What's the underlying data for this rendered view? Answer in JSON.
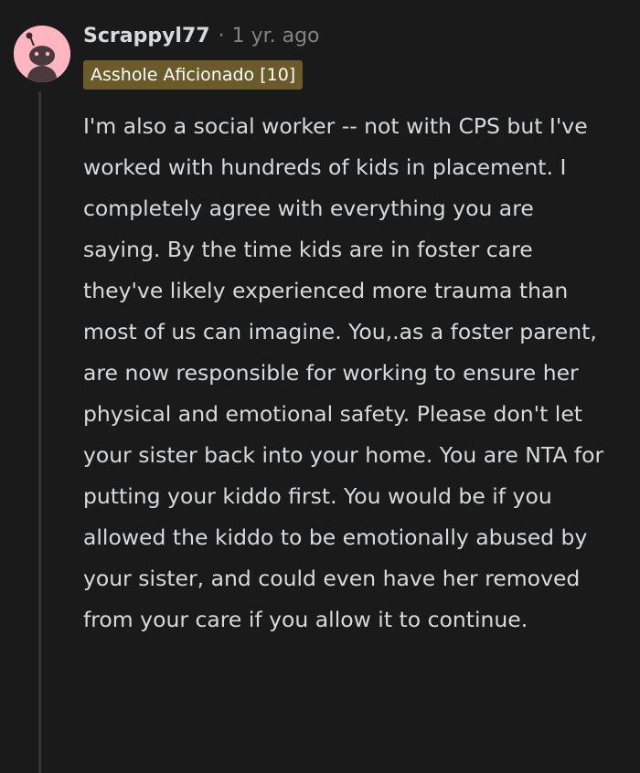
{
  "comment": {
    "username": "Scrappyl77",
    "separator": "·",
    "timestamp": "1 yr. ago",
    "flair": "Asshole Aficionado [10]",
    "flair_color": "#6b5b2a",
    "avatar_icon": "snoo-avatar-icon",
    "avatar_color": "#ffb6c1",
    "body": "I'm also a social worker -- not with CPS but I've worked with hundreds of kids in placement. I completely agree with everything you are saying. By the time kids are in foster care they've likely experienced more trauma than most of us can imagine. You,.as a foster parent, are now responsible for working to ensure her physical and emotional safety. Please don't let your sister back into your home. You are NTA for putting your kiddo first. You would be if you allowed the kiddo to be emotionally abused by your sister, and could even have her removed from your care if you allow it to continue."
  }
}
